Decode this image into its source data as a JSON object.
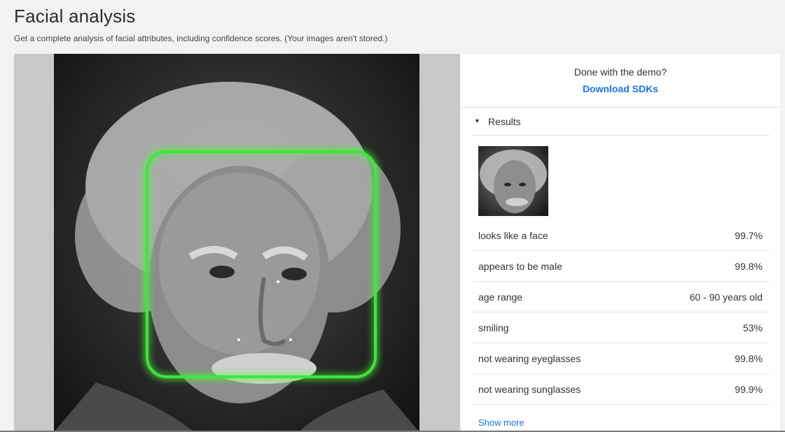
{
  "page": {
    "title": "Facial analysis",
    "subtitle": "Get a complete analysis of facial attributes, including confidence scores. (Your images aren't stored.)"
  },
  "panel": {
    "demo_text": "Done with the demo?",
    "download_label": "Download SDKs",
    "results_label": "Results",
    "results_icon": "caret-down-icon",
    "attributes": [
      {
        "label": "looks like a face",
        "value": "99.7%"
      },
      {
        "label": "appears to be male",
        "value": "99.8%"
      },
      {
        "label": "age range",
        "value": "60 - 90 years old"
      },
      {
        "label": "smiling",
        "value": "53%"
      },
      {
        "label": "not wearing eyeglasses",
        "value": "99.8%"
      },
      {
        "label": "not wearing sunglasses",
        "value": "99.9%"
      }
    ],
    "show_more_label": "Show more"
  },
  "colors": {
    "face_box": "#3fe63a",
    "link": "#1a73e8",
    "background": "#f2f2f2"
  }
}
